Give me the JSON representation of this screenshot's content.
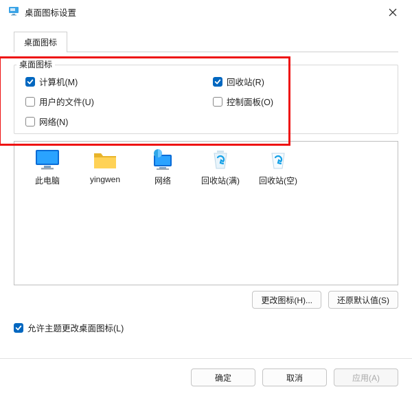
{
  "window": {
    "title": "桌面图标设置"
  },
  "tabs": {
    "desktop_icons": "桌面图标"
  },
  "group": {
    "legend": "桌面图标",
    "computer": {
      "label": "计算机(M)",
      "checked": true
    },
    "recycle": {
      "label": "回收站(R)",
      "checked": true
    },
    "userfiles": {
      "label": "用户的文件(U)",
      "checked": false
    },
    "control": {
      "label": "控制面板(O)",
      "checked": false
    },
    "network": {
      "label": "网络(N)",
      "checked": false
    }
  },
  "icons": {
    "this_pc": "此电脑",
    "yingwen": "yingwen",
    "network": "网络",
    "recycle_full": "回收站(满)",
    "recycle_empty": "回收站(空)"
  },
  "buttons": {
    "change_icon": "更改图标(H)...",
    "restore_default": "还原默认值(S)",
    "ok": "确定",
    "cancel": "取消",
    "apply": "应用(A)"
  },
  "allow_themes": {
    "label": "允许主题更改桌面图标(L)",
    "checked": true
  }
}
